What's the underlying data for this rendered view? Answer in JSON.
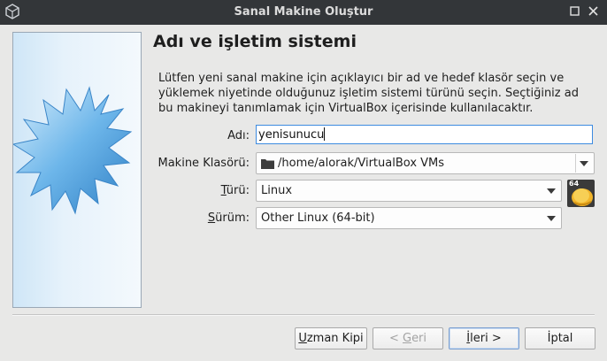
{
  "window": {
    "title": "Sanal Makine Oluştur"
  },
  "page": {
    "heading": "Adı ve işletim sistemi",
    "description": "Lütfen yeni sanal makine için açıklayıcı bir ad ve hedef klasör seçin ve yüklemek niyetinde olduğunuz işletim sistemi türünü seçin. Seçtiğiniz ad bu makineyi tanımlamak için VirtualBox içerisinde kullanılacaktır."
  },
  "form": {
    "name": {
      "label": "Adı:",
      "value": "yenisunucu"
    },
    "folder": {
      "label": "Makine Klasörü:",
      "value": "/home/alorak/VirtualBox VMs"
    },
    "type": {
      "label_pre": "",
      "label_u": "T",
      "label_post": "ürü:",
      "value": "Linux"
    },
    "version": {
      "label_pre": "",
      "label_u": "S",
      "label_post": "ürüm:",
      "value": "Other Linux (64-bit)"
    },
    "os_badge": "64"
  },
  "buttons": {
    "expert": {
      "u": "U",
      "rest": "zman Kipi"
    },
    "back": {
      "pre": "< ",
      "u": "G",
      "rest": "eri"
    },
    "next": {
      "u": "İ",
      "rest": "leri >"
    },
    "cancel": {
      "label": "İptal"
    }
  },
  "colors": {
    "titlebar": "#333639",
    "background": "#e8e8e7",
    "focus": "#3d8be0",
    "banner_star": "#5aa7e0"
  },
  "icons": {
    "app": "virtualbox-cube-icon",
    "maximize": "maximize-icon",
    "close": "close-icon",
    "folder": "folder-icon",
    "os": "linux-64-os-icon"
  }
}
